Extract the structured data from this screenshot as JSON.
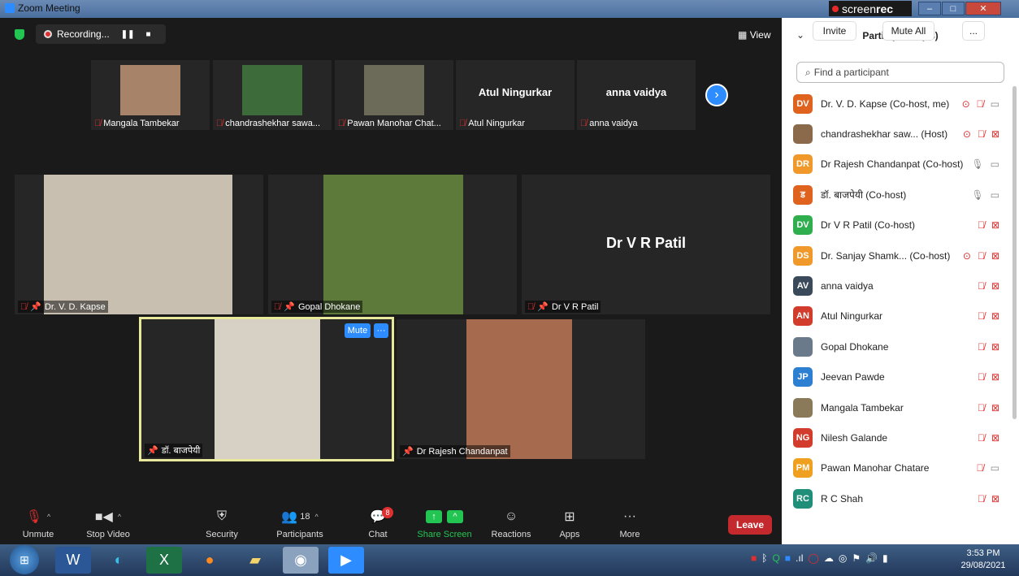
{
  "window": {
    "title": "Zoom Meeting",
    "screenrec_prefix": "screen",
    "screenrec_brand": "rec"
  },
  "topbar": {
    "recording_label": "Recording...",
    "view_label": "View"
  },
  "strip": [
    {
      "name": "Mangala Tambekar",
      "photo_color": "#a7836a"
    },
    {
      "name": "chandrashekhar sawa...",
      "photo_color": "#3d6b3a"
    },
    {
      "name": "Pawan Manohar Chat...",
      "photo_color": "#6c6a59"
    },
    {
      "name": "Atul Ningurkar",
      "big_name": "Atul Ningurkar"
    },
    {
      "name": "anna vaidya",
      "big_name": "anna vaidya"
    }
  ],
  "tiles": [
    {
      "name": "Dr. V. D. Kapse",
      "photo_color": "#c9bfb1"
    },
    {
      "name": "Gopal Dhokane",
      "photo_color": "#5d7a3b"
    },
    {
      "name": "Dr V R Patil",
      "big_name": "Dr V R Patil"
    },
    {
      "name": "डॉ. बाजपेयी",
      "photo_color": "#d7d1c5"
    },
    {
      "name": "Dr Rajesh Chandanpat",
      "photo_color": "#a66a4f"
    }
  ],
  "active_speaker": {
    "mute_label": "Mute",
    "more_label": "···"
  },
  "toolbar": {
    "unmute": "Unmute",
    "stop_video": "Stop Video",
    "security": "Security",
    "participants": "Participants",
    "participants_count": "18",
    "chat": "Chat",
    "chat_badge": "8",
    "share_screen": "Share Screen",
    "reactions": "Reactions",
    "apps": "Apps",
    "more": "More",
    "leave": "Leave"
  },
  "panel": {
    "title": "Participants (18)",
    "search_placeholder": "Find a participant",
    "participants": [
      {
        "initials": "DV",
        "color": "#e0621f",
        "name": "Dr. V. D. Kapse (Co-host, me)",
        "rec": true,
        "mic": "off",
        "cam": "on"
      },
      {
        "initials": "",
        "color": "#8a6a4a",
        "name": "chandrashekhar saw... (Host)",
        "rec": true,
        "mic": "off",
        "cam": "off"
      },
      {
        "initials": "DR",
        "color": "#f0982a",
        "name": "Dr Rajesh Chandanpat (Co-host)",
        "rec": false,
        "mic": "on",
        "cam": "on"
      },
      {
        "initials": "ड",
        "color": "#e0621f",
        "name": "डॉ. बाजपेयी (Co-host)",
        "rec": false,
        "mic": "on",
        "cam": "on"
      },
      {
        "initials": "DV",
        "color": "#2fae4e",
        "name": "Dr V R Patil (Co-host)",
        "rec": false,
        "mic": "off",
        "cam": "off"
      },
      {
        "initials": "DS",
        "color": "#f0982a",
        "name": "Dr. Sanjay Shamk...  (Co-host)",
        "rec": true,
        "mic": "off",
        "cam": "off"
      },
      {
        "initials": "AV",
        "color": "#3b4a5a",
        "name": "anna vaidya",
        "rec": false,
        "mic": "off",
        "cam": "off"
      },
      {
        "initials": "AN",
        "color": "#d23c2c",
        "name": "Atul Ningurkar",
        "rec": false,
        "mic": "off",
        "cam": "off"
      },
      {
        "initials": "",
        "color": "#6b7a8a",
        "name": "Gopal Dhokane",
        "rec": false,
        "mic": "off",
        "cam": "off"
      },
      {
        "initials": "JP",
        "color": "#2d7fd1",
        "name": "Jeevan Pawde",
        "rec": false,
        "mic": "off",
        "cam": "off"
      },
      {
        "initials": "",
        "color": "#8a7a5a",
        "name": "Mangala Tambekar",
        "rec": false,
        "mic": "off",
        "cam": "off"
      },
      {
        "initials": "NG",
        "color": "#d23c2c",
        "name": "Nilesh Galande",
        "rec": false,
        "mic": "off",
        "cam": "off"
      },
      {
        "initials": "PM",
        "color": "#f0a020",
        "name": "Pawan Manohar Chatare",
        "rec": false,
        "mic": "off",
        "cam": "on"
      },
      {
        "initials": "RC",
        "color": "#1f8f7a",
        "name": "R C Shah",
        "rec": false,
        "mic": "off",
        "cam": "off"
      }
    ],
    "invite": "Invite",
    "mute_all": "Mute All",
    "more": "..."
  },
  "taskbar": {
    "time": "3:53 PM",
    "date": "29/08/2021"
  },
  "colors": {
    "accent": "#2d8cff",
    "danger": "#e02f2f",
    "success": "#23c552",
    "leave": "#c4292d"
  }
}
